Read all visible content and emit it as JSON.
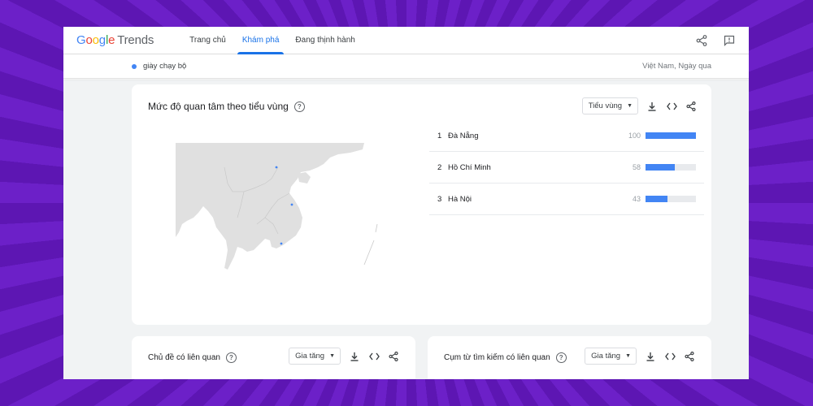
{
  "app": {
    "logo_google": "Google",
    "logo_trends": "Trends"
  },
  "nav": [
    {
      "label": "Trang chủ",
      "active": false
    },
    {
      "label": "Khám phá",
      "active": true
    },
    {
      "label": "Đang thịnh hành",
      "active": false
    }
  ],
  "top_icons": [
    "share-icon",
    "feedback-icon"
  ],
  "search": {
    "term": "giày chạy bộ",
    "term_color": "#4285f4",
    "region_date": "Việt Nam, Ngày qua"
  },
  "interest_by_subregion": {
    "title": "Mức độ quan tâm theo tiểu vùng",
    "select_label": "Tiểu vùng",
    "rows": [
      {
        "rank": "1",
        "name": "Đà Nẵng",
        "value": "100",
        "level": 1.0
      },
      {
        "rank": "2",
        "name": "Hồ Chí Minh",
        "value": "58",
        "level": 0.58
      },
      {
        "rank": "3",
        "name": "Hà Nội",
        "value": "43",
        "level": 0.43
      }
    ],
    "bar_color": "#4285f4"
  },
  "related_topics": {
    "title": "Chủ đề có liên quan",
    "select_label": "Gia tăng"
  },
  "related_queries": {
    "title": "Cụm từ tìm kiếm có liên quan",
    "select_label": "Gia tăng"
  },
  "colors": {
    "accent": "#1a73e8",
    "background": "#6a1fc4"
  }
}
